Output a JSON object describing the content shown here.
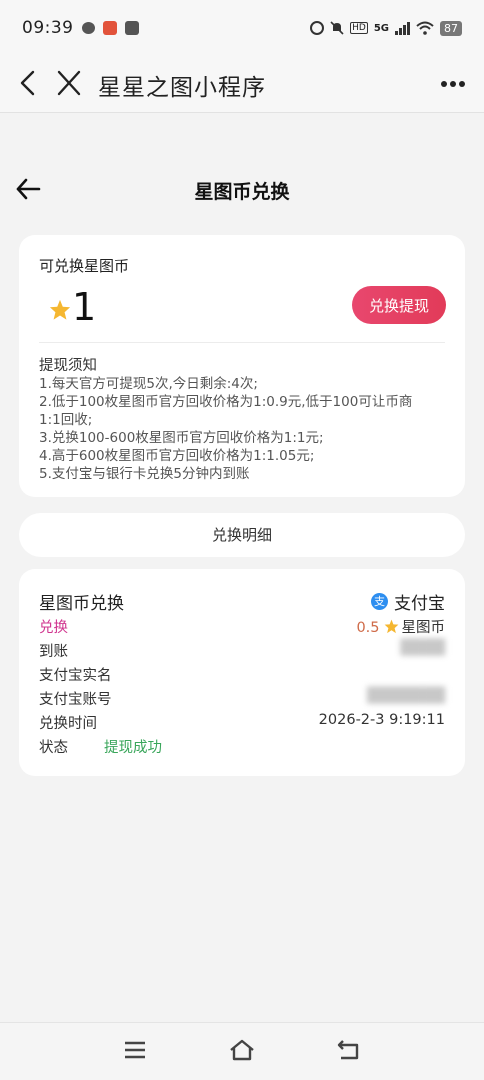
{
  "status_bar": {
    "time": "09:39",
    "network": "5G",
    "hd": "HD",
    "battery": "87"
  },
  "mini_program": {
    "title": "星星之图小程序"
  },
  "page": {
    "title": "星图币兑换"
  },
  "balance": {
    "label": "可兑换星图币",
    "value": "1",
    "withdraw_button": "兑换提现"
  },
  "notice": {
    "title": "提现须知",
    "lines": [
      "1.每天官方可提现5次,今日剩余:4次;",
      "2.低于100枚星图币官方回收价格为1:0.9元,低于100可让币商",
      "1:1回收;",
      "3.兑换100-600枚星图币官方回收价格为1:1元;",
      "4.高于600枚星图币官方回收价格为1:1.05元;",
      "5.支付宝与银行卡兑换5分钟内到账"
    ]
  },
  "detail_tab": {
    "label": "兑换明细"
  },
  "record": {
    "title": "星图币兑换",
    "method": "支付宝",
    "method_icon": "alipay-icon",
    "type_label": "兑换",
    "amount": "0.5",
    "amount_unit": "星图币",
    "arrive_label": "到账",
    "name_label": "支付宝实名",
    "account_label": "支付宝账号",
    "time_label": "兑换时间",
    "time_value": "2026-2-3 9:19:11",
    "status_label": "状态",
    "status_value": "提现成功"
  },
  "colors": {
    "accent_button": "#e23b59",
    "pink_text": "#d0368f",
    "amount_text": "#cf6b49",
    "success_text": "#3aa65b",
    "star": "#f5b731",
    "alipay": "#2d8ef0"
  }
}
